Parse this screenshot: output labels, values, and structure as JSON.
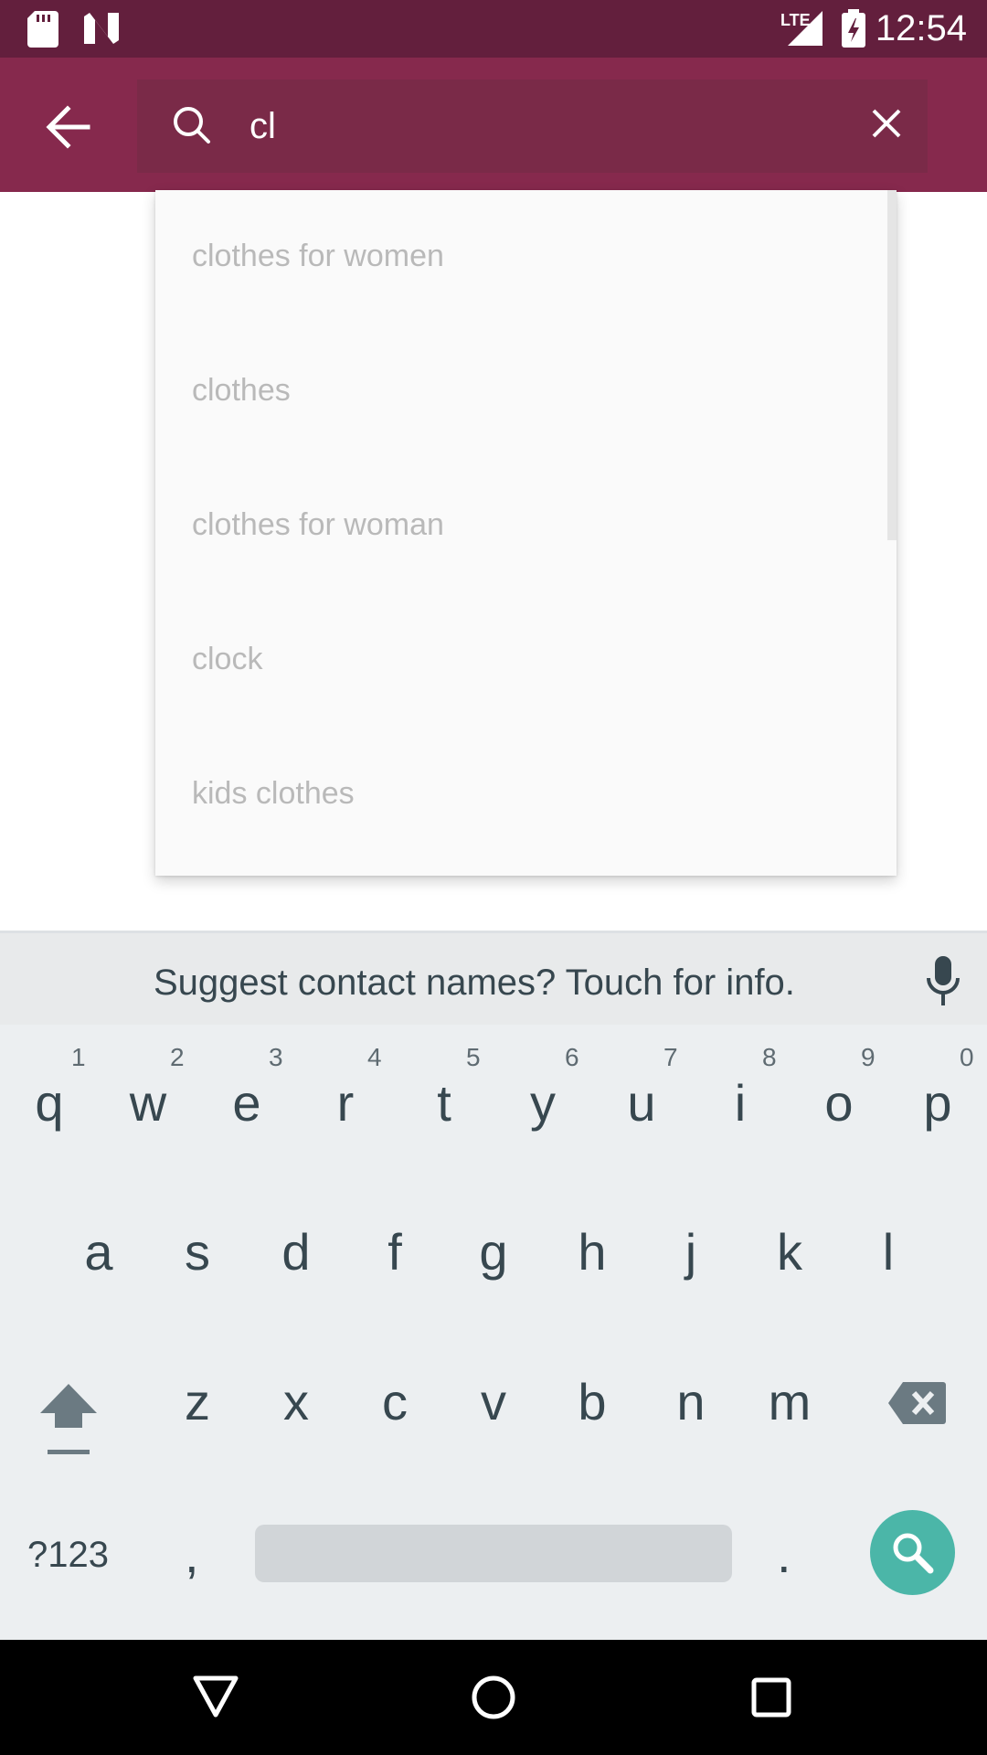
{
  "status_bar": {
    "time": "12:54",
    "network": "LTE",
    "icons": [
      "sd-card-icon",
      "n-icon",
      "signal-icon",
      "battery-charging-icon"
    ]
  },
  "search": {
    "query": "cl",
    "back_icon": "arrow-back-icon",
    "search_icon": "search-icon",
    "clear_icon": "close-icon"
  },
  "suggestions": [
    {
      "label": "clothes for women"
    },
    {
      "label": "clothes"
    },
    {
      "label": "clothes for woman"
    },
    {
      "label": "clock"
    },
    {
      "label": "kids clothes"
    }
  ],
  "keyboard": {
    "suggestion_strip": "Suggest contact names? Touch for info.",
    "row1": [
      {
        "letter": "q",
        "hint": "1"
      },
      {
        "letter": "w",
        "hint": "2"
      },
      {
        "letter": "e",
        "hint": "3"
      },
      {
        "letter": "r",
        "hint": "4"
      },
      {
        "letter": "t",
        "hint": "5"
      },
      {
        "letter": "y",
        "hint": "6"
      },
      {
        "letter": "u",
        "hint": "7"
      },
      {
        "letter": "i",
        "hint": "8"
      },
      {
        "letter": "o",
        "hint": "9"
      },
      {
        "letter": "p",
        "hint": "0"
      }
    ],
    "row2": [
      "a",
      "s",
      "d",
      "f",
      "g",
      "h",
      "j",
      "k",
      "l"
    ],
    "row3": [
      "z",
      "x",
      "c",
      "v",
      "b",
      "n",
      "m"
    ],
    "symbols_label": "?123",
    "comma": ",",
    "period": ".",
    "accent_color": "#4bb6a8"
  },
  "colors": {
    "status_bar": "#631f3d",
    "app_bar": "#86294d"
  }
}
